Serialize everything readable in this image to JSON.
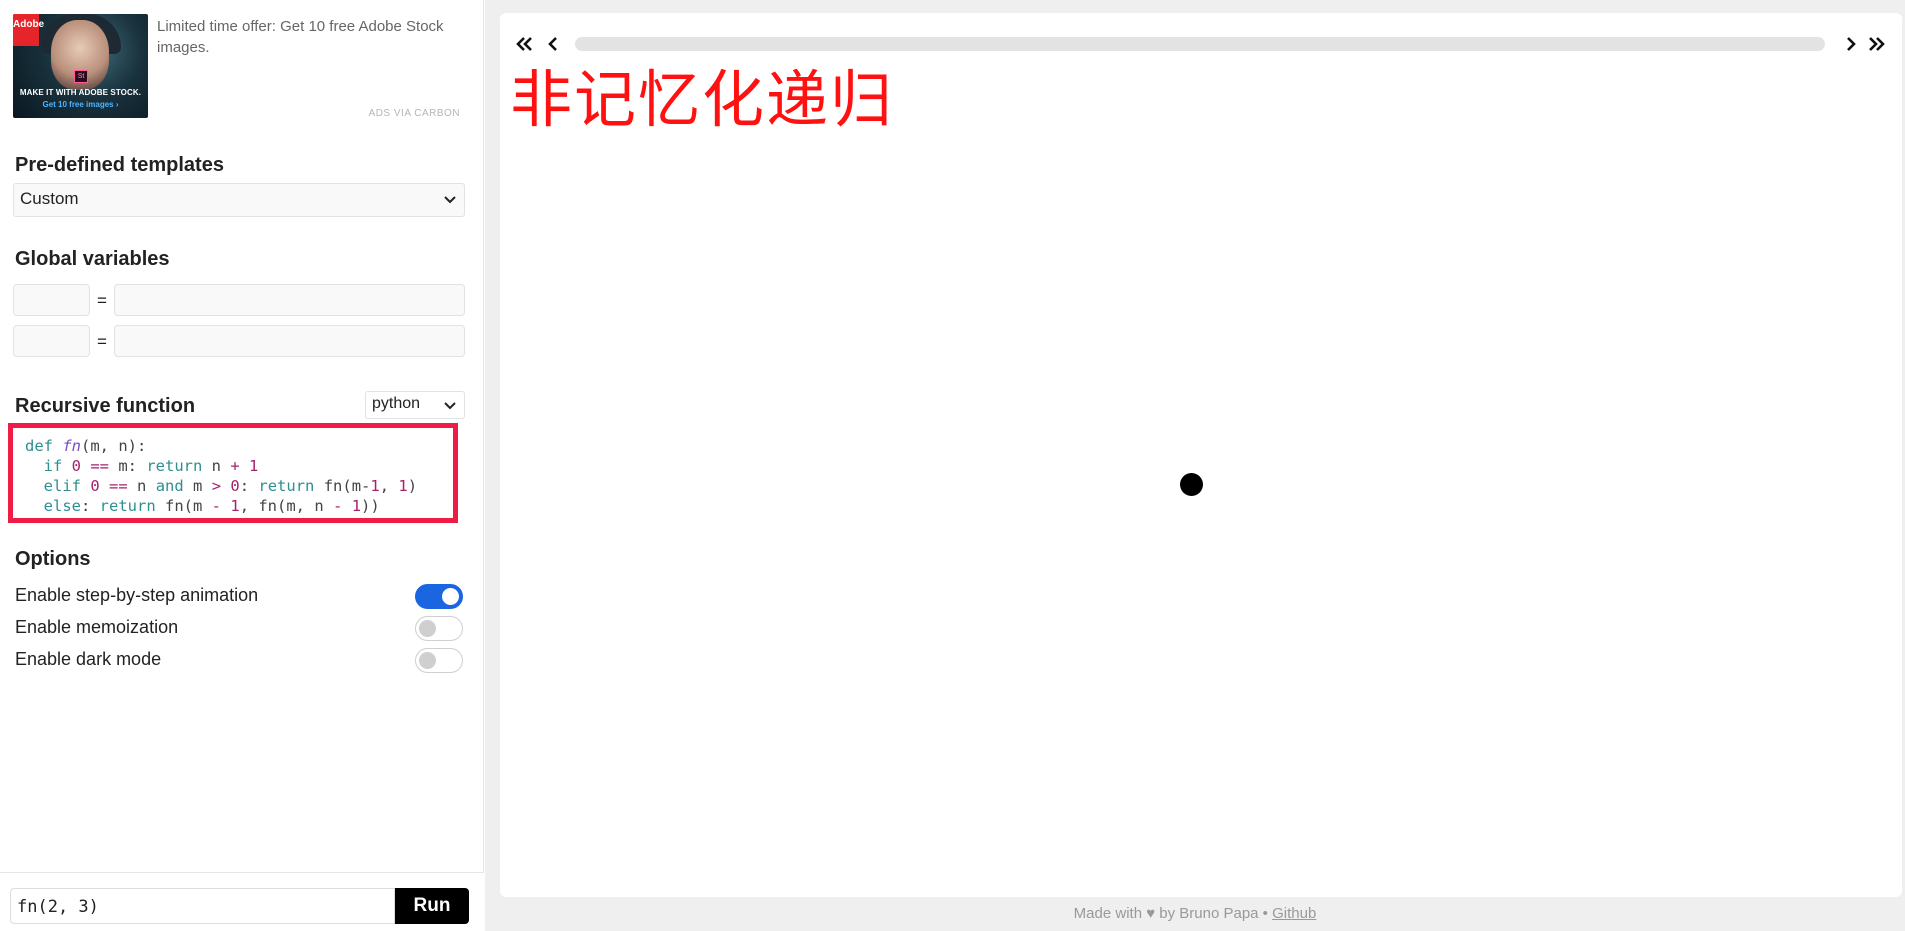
{
  "ad": {
    "text": "Limited time offer: Get 10 free Adobe Stock images.",
    "via": "ADS VIA CARBON",
    "image": {
      "logo": "Adobe",
      "badge": "St",
      "line1": "MAKE IT WITH ADOBE STOCK.",
      "line2": "Get 10 free images ›"
    }
  },
  "templates": {
    "title": "Pre-defined templates",
    "selected": "Custom"
  },
  "globals": {
    "title": "Global variables",
    "rows": [
      {
        "name": "",
        "equals": "=",
        "value": ""
      },
      {
        "name": "",
        "equals": "=",
        "value": ""
      }
    ]
  },
  "recursive": {
    "title": "Recursive function",
    "language": "python",
    "code_lines": [
      "def fn(m, n):",
      "  if 0 == m: return n + 1",
      "  elif 0 == n and m > 0: return fn(m-1, 1)",
      "  else: return fn(m - 1, fn(m, n - 1))"
    ]
  },
  "options": {
    "title": "Options",
    "items": [
      {
        "label": "Enable step-by-step animation",
        "enabled": true
      },
      {
        "label": "Enable memoization",
        "enabled": false
      },
      {
        "label": "Enable dark mode",
        "enabled": false
      }
    ]
  },
  "run": {
    "call": "fn(2, 3)",
    "button": "Run"
  },
  "canvas": {
    "overlay_text": "非记忆化递归",
    "progress": 0
  },
  "footer": {
    "text": "Made with ♥ by Bruno Papa •",
    "link": "Github"
  },
  "colors": {
    "accent": "#1a66e0",
    "highlight_border": "#ef1c45",
    "overlay_text": "#ff1111"
  },
  "icons": [
    "chevron-down-icon",
    "double-chevron-left-icon",
    "chevron-left-icon",
    "chevron-right-icon",
    "double-chevron-right-icon"
  ]
}
